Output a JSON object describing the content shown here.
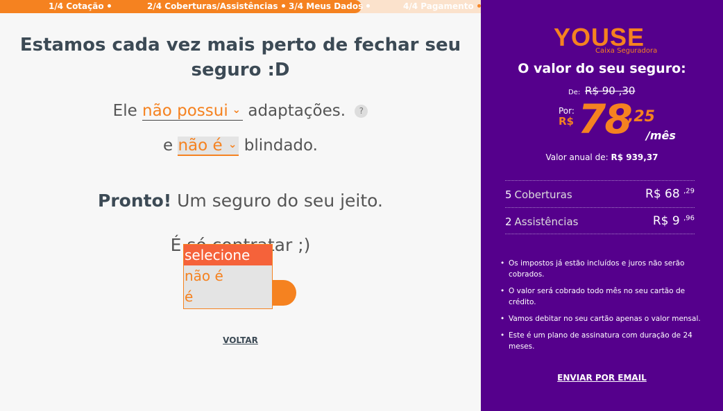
{
  "progress": {
    "steps": [
      {
        "label": "1/4 Cotação"
      },
      {
        "label": "2/4 Coberturas/Assistências"
      },
      {
        "label": "3/4 Meus Dados"
      },
      {
        "label": "4/4 Pagamento"
      }
    ],
    "completed_fraction": 0.75
  },
  "main": {
    "headline": "Estamos cada vez mais perto de fechar seu seguro :D",
    "sentence1": {
      "prefix": "Ele",
      "select_value": "não possui",
      "suffix": "adaptações.",
      "help": "?"
    },
    "sentence2": {
      "prefix": "e",
      "select_value": "não é",
      "suffix": "blindado."
    },
    "ready_bold": "Pronto!",
    "ready_rest": "Um seguro do seu jeito.",
    "just_sign": "É só contratar ;)",
    "dropdown_options": [
      "selecione",
      "não é",
      "é"
    ],
    "back_label": "VOLTAR"
  },
  "sidebar": {
    "brand": "YOUSE",
    "brand_sub": "Caixa Seguradora",
    "title": "O valor do seu seguro:",
    "from_label": "De:",
    "old_price": "R$ 90 ,30",
    "por_label": "Por:",
    "currency": "R$",
    "price_int": "78",
    "price_dec": ",25",
    "per_month": "/mês",
    "annual_label": "Valor anual de:",
    "annual_value": "R$ 939,37",
    "rows": [
      {
        "count": "5",
        "label": "Coberturas",
        "value": "R$ 68",
        "cents": ",29"
      },
      {
        "count": "2",
        "label": "Assistências",
        "value": "R$ 9",
        "cents": ",96"
      }
    ],
    "notes": [
      "Os impostos já estão incluídos e juros não serão cobrados.",
      "O valor será cobrado todo mês no seu cartão de crédito.",
      "Vamos debitar no seu cartão apenas o valor mensal.",
      "Este é um plano de assinatura com duração de 24 meses."
    ],
    "email_label": "ENVIAR POR EMAIL"
  },
  "colors": {
    "accent": "#f58220",
    "sidebar_bg": "#55008c",
    "dropdown_highlight": "#f5623a"
  }
}
